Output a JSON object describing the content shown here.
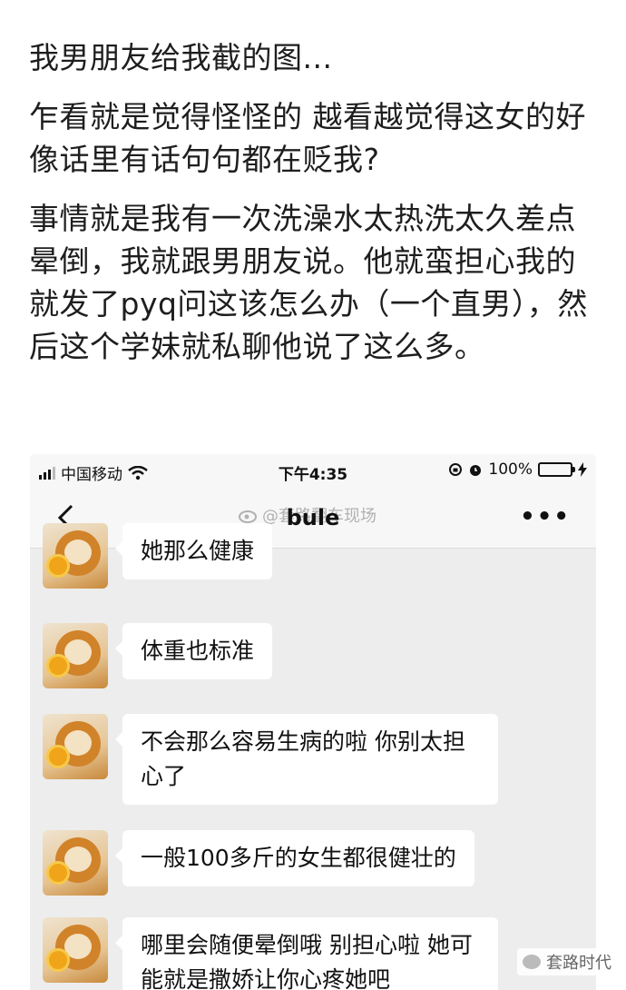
{
  "post": {
    "paragraphs": [
      "我男朋友给我截的图...",
      "乍看就是觉得怪怪的 越看越觉得这女的好像话里有话句句都在贬我?",
      "事情就是我有一次洗澡水太热洗太久差点晕倒，我就跟男朋友说。他就蛮担心我的就发了pyq问这该怎么办（一个直男），然后这个学妹就私聊他说了这么多。"
    ]
  },
  "screenshot": {
    "status_bar": {
      "carrier": "中国移动",
      "time": "下午4:35",
      "battery": "100%",
      "battery_level": 1.0,
      "icons": [
        "signal-icon",
        "wifi-icon",
        "rotation-lock-icon",
        "alarm-icon",
        "battery-icon",
        "charging-icon"
      ]
    },
    "nav": {
      "title": "bule",
      "back_icon": "chevron-left-icon",
      "more_icon": "more-icon",
      "more_glyph": "•••"
    },
    "watermark_weibo": "@套路翻车现场",
    "messages": [
      {
        "text": "她那么健康"
      },
      {
        "text": "体重也标准"
      },
      {
        "text": "不会那么容易生病的啦 你别太担心了"
      },
      {
        "text": "一般100多斤的女生都很健壮的"
      },
      {
        "text": "哪里会随便晕倒哦 别担心啦 她可能就是撒娇让你心疼她吧"
      }
    ]
  },
  "watermark_corner": "套路时代",
  "colors": {
    "chat_bg": "#ededed",
    "bubble": "#ffffff",
    "battery_fill": "#3cc13b"
  }
}
